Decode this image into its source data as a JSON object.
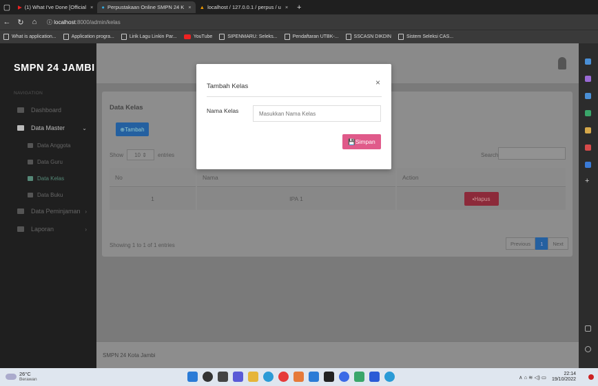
{
  "browser": {
    "tabs": [
      {
        "label": "(1) What I've Done [Official"
      },
      {
        "label": "Perpustakaan Online SMPN 24 K"
      },
      {
        "label": "localhost / 127.0.0.1 / perpus / u"
      }
    ],
    "url_host": "localhost",
    "url_path": ":8000/admin/kelas",
    "bookmarks": [
      {
        "label": "What is application..."
      },
      {
        "label": "Application progra..."
      },
      {
        "label": "Lirik Lagu Linkin Par..."
      },
      {
        "label": "YouTube"
      },
      {
        "label": "SIPENMARU: Seleks..."
      },
      {
        "label": "Pendaftaran UTBK-..."
      },
      {
        "label": "SSCASN DIKDIN"
      },
      {
        "label": "Sistem Seleksi CAS..."
      }
    ]
  },
  "sidebar": {
    "brand": "SMPN 24 JAMBI",
    "nav_label": "NAVIGATION",
    "items": [
      {
        "label": "Dashboard"
      },
      {
        "label": "Data Master"
      },
      {
        "label": "Data Anggota"
      },
      {
        "label": "Data Guru"
      },
      {
        "label": "Data Kelas"
      },
      {
        "label": "Data Buku"
      },
      {
        "label": "Data Peminjaman"
      },
      {
        "label": "Laporan"
      }
    ]
  },
  "card": {
    "title": "Data Kelas",
    "add_label": "Tambah",
    "show_prefix": "Show",
    "show_value": "10",
    "show_suffix": "entries",
    "search_label": "Search:",
    "columns": [
      "No",
      "Nama",
      "Action"
    ],
    "rows": [
      {
        "no": "1",
        "nama": "IPA 1",
        "action": "Hapus"
      }
    ],
    "info": "Showing 1 to 1 of 1 entries",
    "pager": {
      "prev": "Previous",
      "page": "1",
      "next": "Next"
    }
  },
  "footer": "SMPN 24 Kota Jambi",
  "modal": {
    "title": "Tambah Kelas",
    "close": "×",
    "field_label": "Nama Kelas",
    "field_placeholder": "Masukkan Nama Kelas",
    "submit": "Simpan"
  },
  "taskbar": {
    "temp": "26°C",
    "weather": "Berawan",
    "time": "22:14",
    "date": "19/10/2022"
  }
}
